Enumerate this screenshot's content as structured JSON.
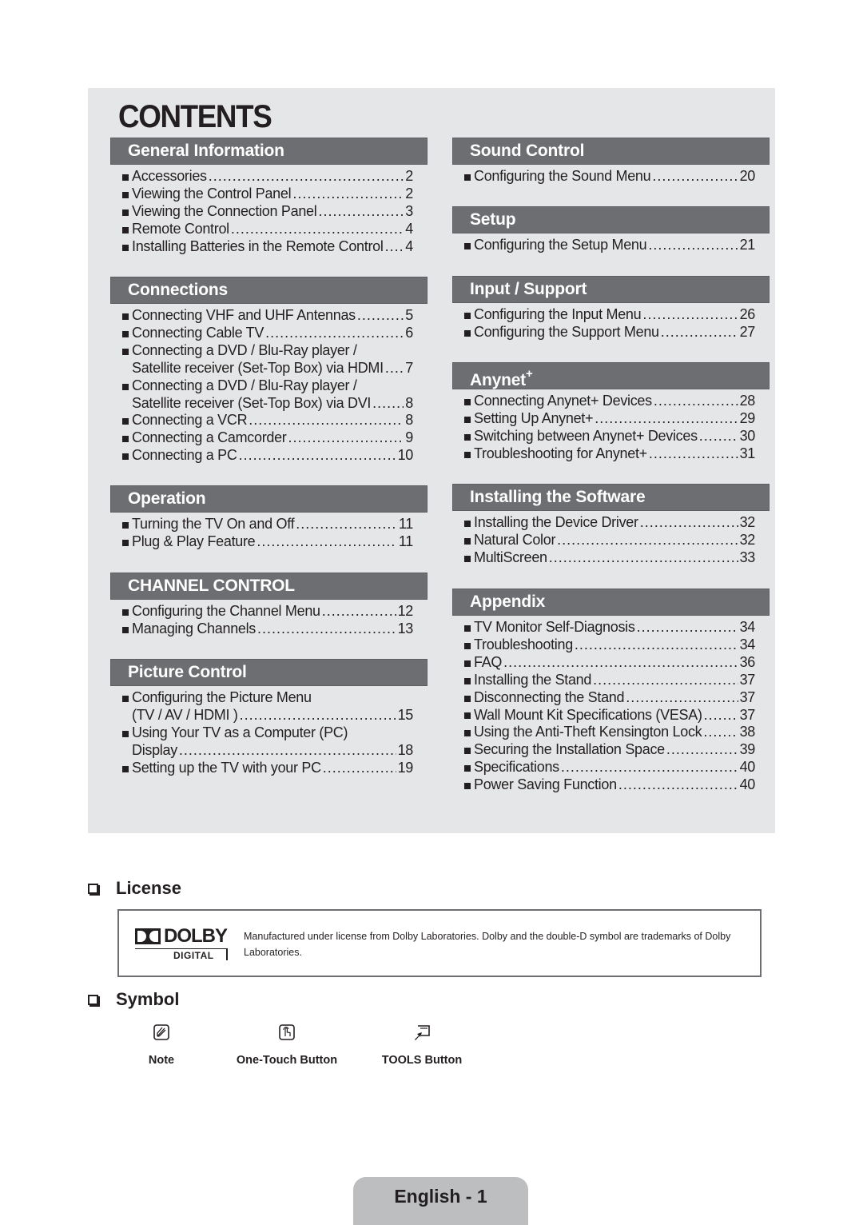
{
  "contents": {
    "title": "CONTENTS",
    "left_column": [
      {
        "heading": "General Information",
        "items": [
          {
            "lines": [
              "Accessories"
            ],
            "page": "2"
          },
          {
            "lines": [
              "Viewing the Control Panel"
            ],
            "page": "2"
          },
          {
            "lines": [
              "Viewing the Connection Panel"
            ],
            "page": "3"
          },
          {
            "lines": [
              "Remote Control"
            ],
            "page": "4"
          },
          {
            "lines": [
              "Installing Batteries in the Remote Control"
            ],
            "page": "4"
          }
        ]
      },
      {
        "heading": "Connections",
        "items": [
          {
            "lines": [
              "Connecting VHF and UHF Antennas"
            ],
            "page": "5"
          },
          {
            "lines": [
              "Connecting Cable TV"
            ],
            "page": "6"
          },
          {
            "lines": [
              "Connecting a DVD / Blu-Ray player /",
              "Satellite receiver (Set-Top Box) via HDMI"
            ],
            "page": "7"
          },
          {
            "lines": [
              "Connecting a DVD / Blu-Ray player /",
              "Satellite receiver (Set-Top Box) via DVI"
            ],
            "page": "8"
          },
          {
            "lines": [
              "Connecting a VCR"
            ],
            "page": "8"
          },
          {
            "lines": [
              "Connecting a Camcorder"
            ],
            "page": "9"
          },
          {
            "lines": [
              "Connecting a PC"
            ],
            "page": "10"
          }
        ]
      },
      {
        "heading": "Operation",
        "items": [
          {
            "lines": [
              "Turning the TV On and Off"
            ],
            "page": "11"
          },
          {
            "lines": [
              "Plug & Play Feature"
            ],
            "page": "11"
          }
        ]
      },
      {
        "heading": "CHANNEL CONTROL",
        "items": [
          {
            "lines": [
              "Configuring the Channel Menu"
            ],
            "page": "12"
          },
          {
            "lines": [
              "Managing Channels"
            ],
            "page": "13"
          }
        ]
      },
      {
        "heading": "Picture Control",
        "items": [
          {
            "lines": [
              "Configuring the Picture Menu",
              "(TV / AV / HDMI )"
            ],
            "page": "15"
          },
          {
            "lines": [
              "Using Your TV as a Computer (PC)",
              "Display"
            ],
            "page": "18"
          },
          {
            "lines": [
              "Setting up the TV with your PC"
            ],
            "page": "19"
          }
        ]
      }
    ],
    "right_column": [
      {
        "heading": "Sound Control",
        "items": [
          {
            "lines": [
              "Configuring the Sound Menu"
            ],
            "page": "20"
          }
        ]
      },
      {
        "heading": "Setup",
        "items": [
          {
            "lines": [
              "Configuring the Setup Menu"
            ],
            "page": "21"
          }
        ]
      },
      {
        "heading": "Input / Support",
        "items": [
          {
            "lines": [
              "Configuring the Input Menu"
            ],
            "page": "26"
          },
          {
            "lines": [
              "Configuring the Support Menu"
            ],
            "page": "27"
          }
        ]
      },
      {
        "heading": "Anynet",
        "heading_sup": "+",
        "items": [
          {
            "lines": [
              "Connecting Anynet+ Devices"
            ],
            "page": "28"
          },
          {
            "lines": [
              "Setting Up Anynet+"
            ],
            "page": "29"
          },
          {
            "lines": [
              "Switching between Anynet+ Devices"
            ],
            "page": "30"
          },
          {
            "lines": [
              "Troubleshooting for Anynet+"
            ],
            "page": "31"
          }
        ]
      },
      {
        "heading": "Installing the Software",
        "items": [
          {
            "lines": [
              "Installing the Device Driver"
            ],
            "page": "32"
          },
          {
            "lines": [
              "Natural Color"
            ],
            "page": "32"
          },
          {
            "lines": [
              "MultiScreen"
            ],
            "page": "33"
          }
        ]
      },
      {
        "heading": "Appendix",
        "items": [
          {
            "lines": [
              "TV Monitor Self-Diagnosis"
            ],
            "page": "34"
          },
          {
            "lines": [
              "Troubleshooting"
            ],
            "page": "34"
          },
          {
            "lines": [
              "FAQ"
            ],
            "page": "36"
          },
          {
            "lines": [
              "Installing the Stand"
            ],
            "page": "37"
          },
          {
            "lines": [
              "Disconnecting the Stand"
            ],
            "page": "37"
          },
          {
            "lines": [
              "Wall Mount Kit Specifications (VESA)"
            ],
            "page": "37"
          },
          {
            "lines": [
              "Using the Anti-Theft Kensington Lock"
            ],
            "page": "38"
          },
          {
            "lines": [
              "Securing the Installation Space"
            ],
            "page": "39"
          },
          {
            "lines": [
              "Specifications"
            ],
            "page": "40"
          },
          {
            "lines": [
              "Power Saving Function"
            ],
            "page": "40"
          }
        ]
      }
    ]
  },
  "license": {
    "heading": "License",
    "logo_word": "DOLBY",
    "logo_sub": "DIGITAL",
    "text": "Manufactured under license from Dolby Laboratories. Dolby and the double-D symbol are trademarks of Dolby Laboratories."
  },
  "symbol": {
    "heading": "Symbol",
    "items": [
      {
        "icon": "note-icon",
        "label": "Note"
      },
      {
        "icon": "one-touch-button-icon",
        "label": "One-Touch Button"
      },
      {
        "icon": "tools-button-icon",
        "label": "TOOLS Button"
      }
    ]
  },
  "footer": {
    "page_label": "English - 1"
  },
  "colors": {
    "panel_bg": "#e5e6e7",
    "section_header_bg": "#6d6e71",
    "page_tab_bg": "#bcbec0",
    "text": "#231f20"
  }
}
